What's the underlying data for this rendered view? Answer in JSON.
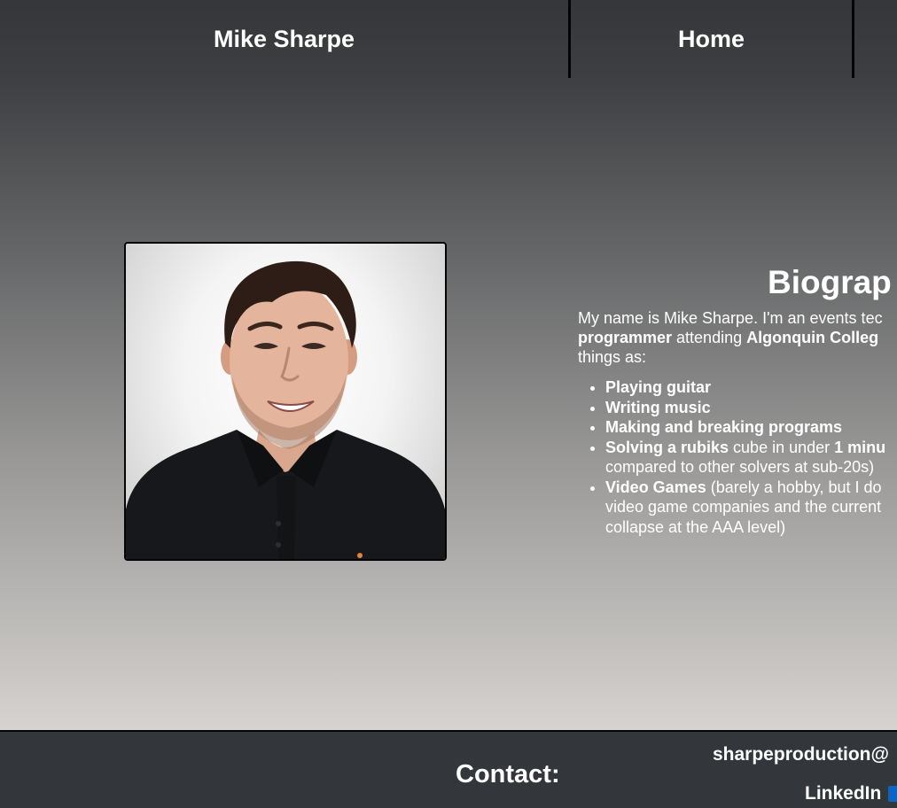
{
  "header": {
    "brand": "Mike Sharpe",
    "nav": {
      "home": "Home"
    }
  },
  "profile": {
    "photo_alt": "Portrait of Mike Sharpe"
  },
  "bio": {
    "heading": "Biograp",
    "intro": {
      "t1": "My name is Mike Sharpe. I'm an events tec",
      "t2": "programmer",
      "t3": " attending ",
      "t4": "Algonquin Colleg",
      "t5": "things as:"
    },
    "items": [
      {
        "bold": "Playing guitar",
        "rest": ""
      },
      {
        "bold": "Writing music",
        "rest": ""
      },
      {
        "bold": "Making and breaking programs",
        "rest": ""
      },
      {
        "bold": "Solving a rubiks",
        "rest": " cube in under ",
        "bold2": "1 minu",
        "rest2": "compared to other solvers at sub-20s)"
      },
      {
        "bold": "Video Games",
        "rest": " (barely a hobby, but I do",
        "rest2": "video game companies and the current",
        "rest3": "collapse at the AAA level)"
      }
    ]
  },
  "footer": {
    "contact_heading": "Contact:",
    "email": "sharpeproduction@",
    "linkedin": "LinkedIn"
  },
  "colors": {
    "header_bg": "#343639",
    "footer_bg": "#33363a",
    "divider": "#050505",
    "linkedin": "#0a66c2"
  }
}
